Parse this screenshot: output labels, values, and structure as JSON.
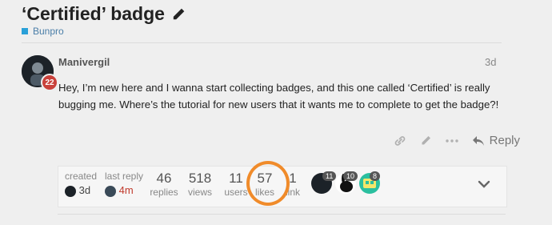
{
  "topic": {
    "title": "‘Certified’ badge",
    "category": "Bunpro",
    "category_color": "#2aa0d8"
  },
  "post": {
    "username": "Manivergil",
    "date": "3d",
    "flair_number": "22",
    "body": "Hey, I’m new here and I wanna start collecting badges, and this one called ‘Certified’ is really bugging me. Where’s the tutorial for new users that it wants me to complete to get the badge?!",
    "reply_label": "Reply"
  },
  "topic_map": {
    "created_label": "created",
    "created_value": "3d",
    "last_reply_label": "last reply",
    "last_reply_value": "4m",
    "replies_value": "46",
    "replies_label": "replies",
    "views_value": "518",
    "views_label": "views",
    "users_value": "11",
    "users_label": "users",
    "likes_value": "57",
    "likes_label": "likes",
    "link_value": "1",
    "link_label": "link",
    "participants": [
      {
        "count": "11"
      },
      {
        "count": "10"
      },
      {
        "count": "8"
      }
    ]
  },
  "highlight_color": "#f08b2a"
}
